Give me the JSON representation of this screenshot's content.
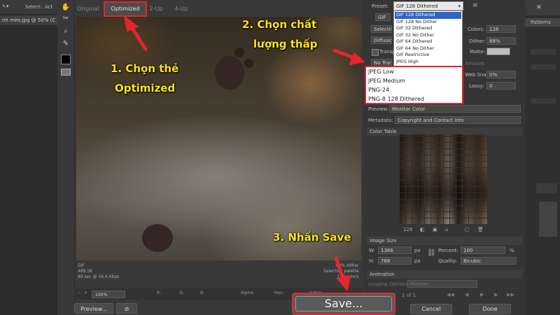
{
  "ps_left": {
    "doc_tab": "nh mèo.jpg @ 50% (C",
    "select_label": "Select:",
    "act_label": "Act"
  },
  "view_tabs": [
    "Original",
    "Optimized",
    "2-Up",
    "4-Up"
  ],
  "image_info_left": [
    "GIF",
    "489.5K",
    "89 sec @ 56.6 Kbps"
  ],
  "image_info_right": [
    "88% dither",
    "Selective palette",
    "128 colors"
  ],
  "statusbar": {
    "zoom": "100%",
    "r": "R:",
    "g": "G:",
    "b": "B:",
    "alpha": "Alpha:",
    "hex": "Hex:",
    "index": "Index:"
  },
  "buttons": {
    "preview": "Preview...",
    "browser": "⊘",
    "save": "Save...",
    "cancel": "Cancel",
    "done": "Done"
  },
  "panel": {
    "preset_label": "Preset:",
    "preset_value": "GIF 128 Dithered",
    "preset_options": [
      "GIF 128 Dithered",
      "GIF 128 No Dither",
      "GIF 32 Dithered",
      "GIF 32 No Dither",
      "GIF 64 Dithered",
      "GIF 64 No Dither",
      "GIF Restrictive",
      "JPEG High"
    ],
    "preset_options_highlight": [
      "JPEG Low",
      "JPEG Medium",
      "PNG-24",
      "PNG-8 128 Dithered"
    ],
    "format": "GIF",
    "reduction": "Selective",
    "dither_algo": "Diffusion",
    "transparency": "Transp",
    "matte_label": "No Transp",
    "colors_label": "Colors:",
    "colors_value": "128",
    "dither_label": "Dither:",
    "dither_value": "88%",
    "matte": "Matte:",
    "amount": "Amount:",
    "web_snap_label": "Web Snap:",
    "web_snap_value": "0%",
    "lossy_label": "Lossy:",
    "lossy_value": "0",
    "preview_label": "Preview:",
    "preview_value": "Monitor Color",
    "metadata_label": "Metadata:",
    "metadata_value": "Copyright and Contact Info",
    "color_table": "Color Table",
    "color_count": "128",
    "image_size": "Image Size",
    "w_label": "W:",
    "w_value": "1366",
    "h_label": "H:",
    "h_value": "768",
    "px": "px",
    "percent_label": "Percent:",
    "percent_value": "100",
    "pct": "%",
    "quality_label": "Quality:",
    "quality_value": "Bicubic",
    "animation": "Animation",
    "looping_label": "Looping Options:",
    "looping_value": "Forever",
    "frame_counter": "1 of 1"
  },
  "ps_right": {
    "patterns": "Patterns"
  },
  "annotations": {
    "step1_line1": "1. Chọn thẻ",
    "step1_line2": "Optimized",
    "step2_line1": "2. Chọn chất",
    "step2_line2": "lượng thấp",
    "step3": "3. Nhấn Save"
  },
  "colors": {
    "annotation_red": "#e3262b",
    "annotation_yellow": "#f6e31a",
    "select_blue": "#2f64c4"
  }
}
